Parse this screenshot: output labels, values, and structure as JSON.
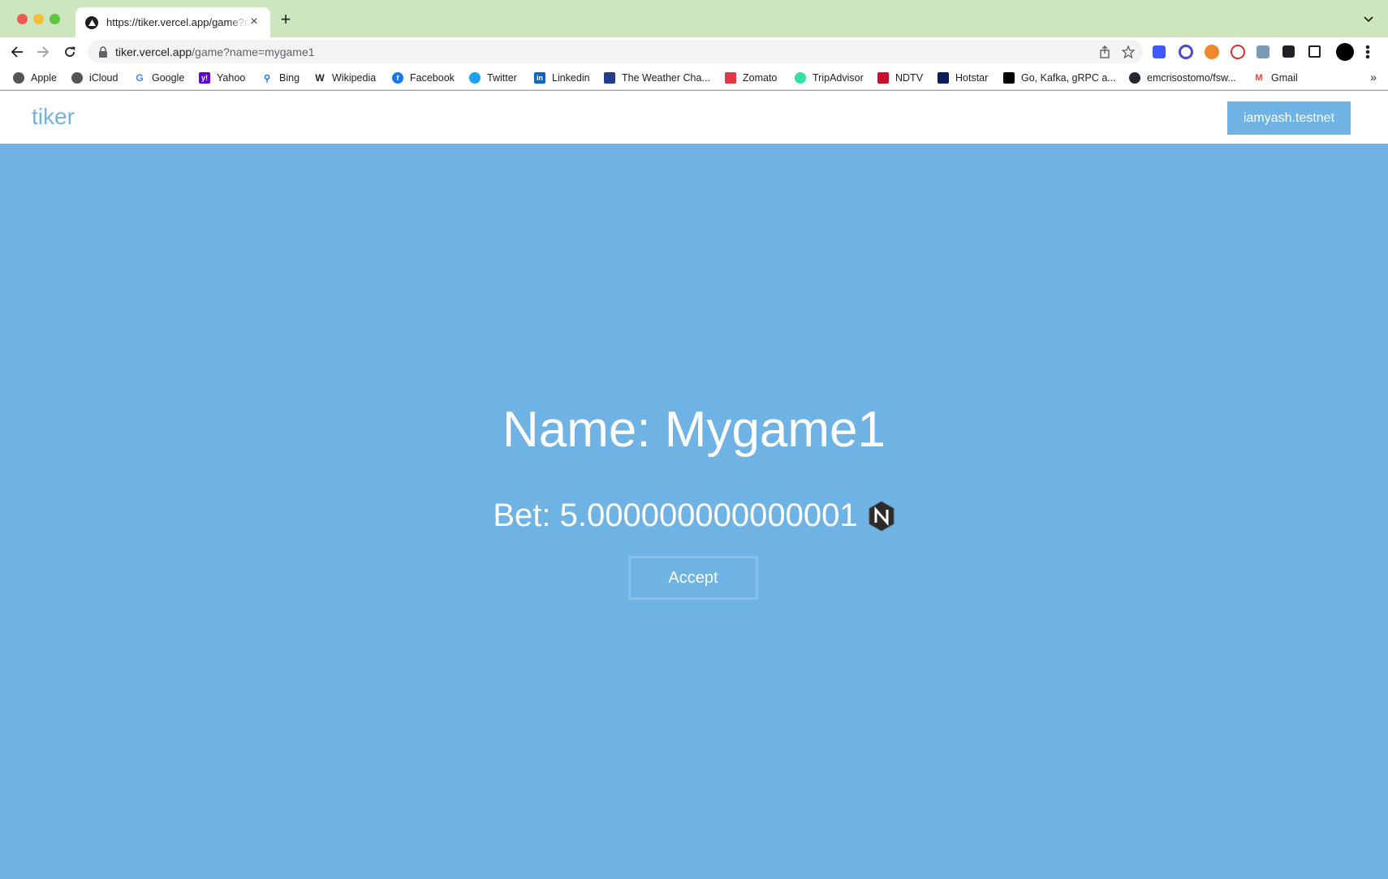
{
  "browser": {
    "tab": {
      "title": "https://tiker.vercel.app/game?name=mygame1"
    },
    "url": {
      "host": "tiker.vercel.app",
      "path": "/game?name=mygame1"
    },
    "bookmarks": [
      {
        "label": "Apple",
        "icon": "apple-icon"
      },
      {
        "label": "iCloud",
        "icon": "apple-icon"
      },
      {
        "label": "Google",
        "icon": "google-icon"
      },
      {
        "label": "Yahoo",
        "icon": "yahoo-icon"
      },
      {
        "label": "Bing",
        "icon": "search-icon"
      },
      {
        "label": "Wikipedia",
        "icon": "wikipedia-icon"
      },
      {
        "label": "Facebook",
        "icon": "facebook-icon"
      },
      {
        "label": "Twitter",
        "icon": "twitter-icon"
      },
      {
        "label": "Linkedin",
        "icon": "linkedin-icon"
      },
      {
        "label": "The Weather Cha...",
        "icon": "weather-icon"
      },
      {
        "label": "Zomato",
        "icon": "zomato-icon"
      },
      {
        "label": "TripAdvisor",
        "icon": "tripadvisor-icon"
      },
      {
        "label": "NDTV",
        "icon": "ndtv-icon"
      },
      {
        "label": "Hotstar",
        "icon": "hotstar-icon"
      },
      {
        "label": "Go, Kafka, gRPC a...",
        "icon": "dev-icon"
      },
      {
        "label": "emcrisostomo/fsw...",
        "icon": "github-icon"
      },
      {
        "label": "Gmail",
        "icon": "gmail-icon"
      }
    ],
    "bookmarks_more": "»"
  },
  "app": {
    "brand": "tiker",
    "account_label": "iamyash.testnet"
  },
  "game": {
    "name_text": "Name: Mygame1",
    "bet_text": "Bet: 5.000000000000001",
    "currency_icon": "near-icon",
    "accept_label": "Accept"
  },
  "colors": {
    "page_bg": "#6fb3e4",
    "tab_strip": "#cde6bd",
    "accent_text": "#ffffff"
  }
}
